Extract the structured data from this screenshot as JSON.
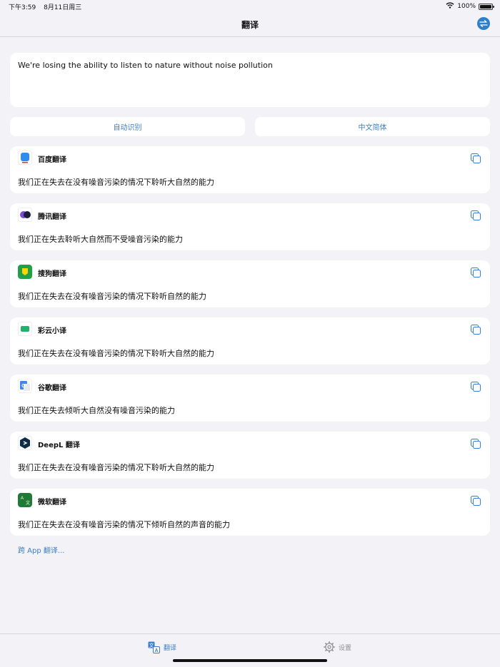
{
  "status_bar": {
    "time": "下午3:59",
    "date": "8月11日周三",
    "battery_text": "100%",
    "battery_level": 1.0
  },
  "nav": {
    "title": "翻译",
    "swap_icon": "swap-arrows-icon"
  },
  "input": {
    "text": "We're losing the ability to listen to nature without noise pollution"
  },
  "languages": {
    "source": "自动识别",
    "target": "中文简体"
  },
  "results": [
    {
      "engine": "百度翻译",
      "icon": "baidu-translate-icon",
      "color": "#2d8cf0",
      "text": "我们正在失去在没有噪音污染的情况下聆听大自然的能力"
    },
    {
      "engine": "腾讯翻译",
      "icon": "tencent-translate-icon",
      "color": "#7a4bd6",
      "text": "我们正在失去聆听大自然而不受噪音污染的能力"
    },
    {
      "engine": "搜狗翻译",
      "icon": "sogou-translate-icon",
      "color": "#1fa14a",
      "text": "我们正在失去在没有噪音污染的情况下聆听自然的能力"
    },
    {
      "engine": "彩云小译",
      "icon": "caiyun-translate-icon",
      "color": "#1fb36a",
      "text": "我们正在失去在没有噪音污染的情况下聆听大自然的能力"
    },
    {
      "engine": "谷歌翻译",
      "icon": "google-translate-icon",
      "color": "#4285f4",
      "text": "我们正在失去倾听大自然没有噪音污染的能力"
    },
    {
      "engine": "DeepL 翻译",
      "icon": "deepl-translate-icon",
      "color": "#0f2b46",
      "text": "我们正在失去在没有噪音污染的情况下聆听大自然的能力"
    },
    {
      "engine": "微软翻译",
      "icon": "microsoft-translate-icon",
      "color": "#1e7a35",
      "text": "我们正在失去在没有噪音污染的情况下倾听自然的声音的能力"
    }
  ],
  "more_link": "跨 App 翻译...",
  "tabs": [
    {
      "label": "翻译",
      "icon": "translate-tab-icon",
      "active": true
    },
    {
      "label": "设置",
      "icon": "gear-icon",
      "active": false
    }
  ],
  "colors": {
    "accent": "#3a7fc3",
    "background": "#f2f2f7"
  }
}
